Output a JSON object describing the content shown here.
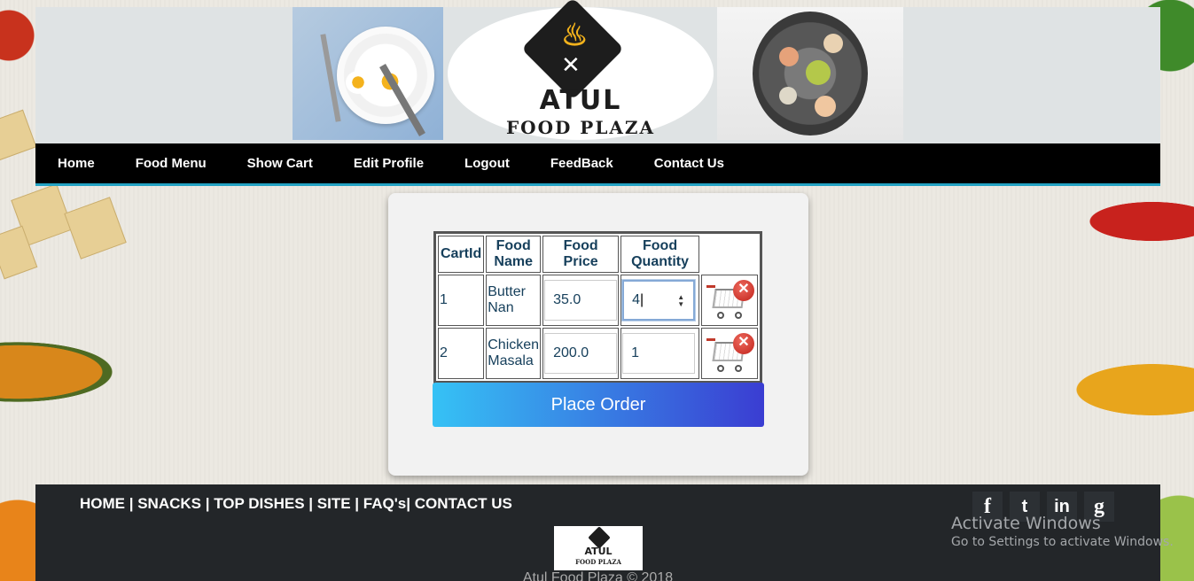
{
  "header": {
    "logo_title": "ATUL",
    "logo_subtitle": "FOOD PLAZA"
  },
  "nav": {
    "items": [
      "Home",
      "Food Menu",
      "Show Cart",
      "Edit Profile",
      "Logout",
      "FeedBack",
      "Contact Us"
    ]
  },
  "cart": {
    "headers": {
      "cart_id": "CartId",
      "food_name": "Food Name",
      "food_price": "Food Price",
      "food_quantity": "Food Quantity"
    },
    "rows": [
      {
        "cart_id": "1",
        "food_name": "Butter Nan",
        "price": "35.0",
        "quantity": "4"
      },
      {
        "cart_id": "2",
        "food_name": "Chicken Masala",
        "price": "200.0",
        "quantity": "1"
      }
    ],
    "remove_icon": "cart-remove-icon",
    "place_order_label": "Place Order"
  },
  "footer": {
    "links": [
      "HOME",
      "SNACKS",
      "TOP DISHES",
      "SITE",
      "FAQ's",
      "CONTACT US"
    ],
    "separators": [
      " | ",
      " | ",
      " | ",
      " | ",
      "| "
    ],
    "socials": [
      {
        "icon": "facebook-icon",
        "glyph": "f"
      },
      {
        "icon": "twitter-icon",
        "glyph": "t"
      },
      {
        "icon": "linkedin-icon",
        "glyph": "in"
      },
      {
        "icon": "google-plus-icon",
        "glyph": "g"
      }
    ],
    "logo_title": "ATUL",
    "logo_subtitle": "FOOD PLAZA",
    "copyright": "Atul Food Plaza © 2018"
  },
  "os_watermark": {
    "title": "Activate Windows",
    "subtitle": "Go to Settings to activate Windows."
  },
  "colors": {
    "nav_accent": "#23a2c3",
    "button_start": "#36c2f5",
    "button_end": "#3a3dd2",
    "footer_bg": "#232629"
  }
}
